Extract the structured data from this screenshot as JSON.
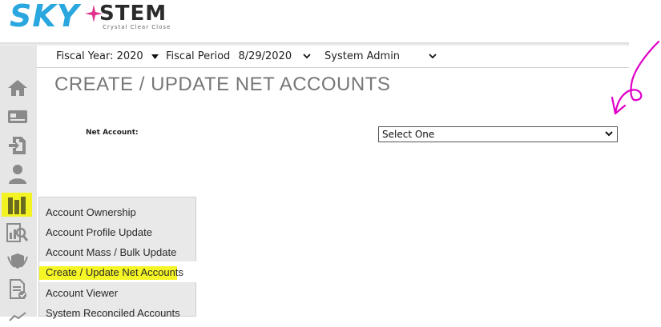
{
  "logo": {
    "sky": "SKY",
    "stem": "STEM",
    "tagline": "Crystal Clear Close"
  },
  "header": {
    "fiscal_year": "Fiscal Year: 2020",
    "fiscal_period_label": "Fiscal Period",
    "fiscal_period_value": "8/29/2020",
    "role": "System Admin"
  },
  "page": {
    "title": "CREATE / UPDATE NET ACCOUNTS",
    "net_account_label": "Net Account:",
    "net_account_value": "Select One"
  },
  "sidebar": {
    "icons": [
      "home-icon",
      "card-icon",
      "import-icon",
      "user-icon",
      "books-icon",
      "report-search-icon",
      "shield-icon",
      "document-check-icon",
      "chart-icon"
    ]
  },
  "menu": {
    "items": [
      {
        "label": "Account Ownership"
      },
      {
        "label": "Account Profile Update"
      },
      {
        "label": "Account Mass / Bulk Update"
      },
      {
        "label": "Create / Update Net Accounts",
        "active": true
      },
      {
        "label": "Account Viewer"
      },
      {
        "label": "System Reconciled Accounts"
      }
    ]
  },
  "colors": {
    "highlight": "#f4f400",
    "annotation": "#e000c8",
    "logo_blue": "#2aa7df",
    "title_gray": "#777777"
  }
}
